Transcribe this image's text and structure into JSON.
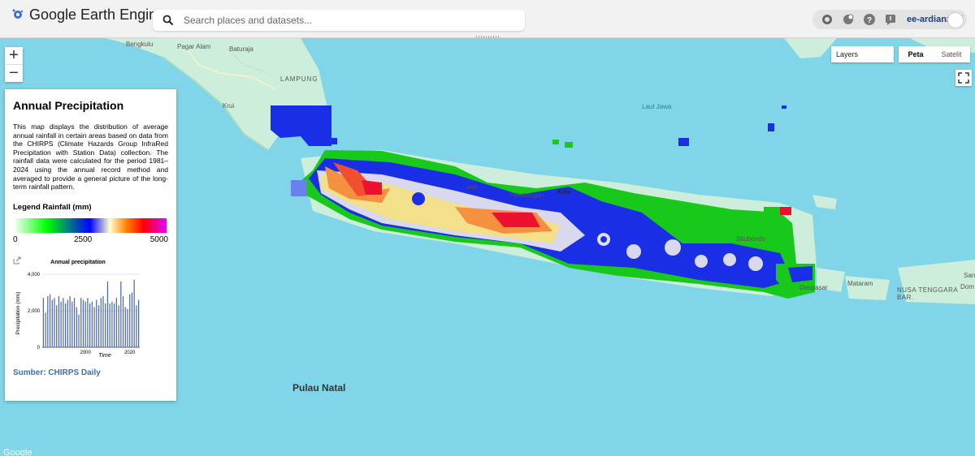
{
  "app": {
    "title": "Google Earth Engine"
  },
  "search": {
    "placeholder": "Search places and datasets..."
  },
  "header": {
    "user": "ee-ardianzaki"
  },
  "map_controls": {
    "zoom_in": "+",
    "zoom_out": "−",
    "layers": "Layers",
    "map_types": [
      "Peta",
      "Satelit"
    ],
    "selected_type": "Peta"
  },
  "panel": {
    "title": "Annual Precipitation",
    "description": "This map displays the distribution of average annual rainfall in certain areas based on data from the CHIRPS (Climate Hazards Group InfraRed Precipitation with Station Data) collection. The rainfall data were calculated for the period 1981–2024 using the annual record method and averaged to provide a general picture of the long-term rainfall pattern.",
    "legend_title": "Legend Rainfall (mm)",
    "legend_labels": [
      "0",
      "2500",
      "5000"
    ],
    "source": "Sumber: CHIRPS Daily"
  },
  "map_labels": {
    "bengkulu": "Bengkulu",
    "pagar_alam": "Pagar Alam",
    "baturaja": "Baturaja",
    "lampung": "LAMPUNG",
    "krui": "Krui",
    "laut_jawa": "Laut Jawa",
    "pulau_natal": "Pulau Natal",
    "mataram": "Mataram",
    "nusa_tenggara": "NUSA TENGGARA BAR.",
    "situbondo": "Situbondo",
    "denpasar": "Denpasar",
    "san": "San",
    "dom": "Dom",
    "pekalongan": "Pekalongan",
    "kota": "Kota",
    "bon": "bon",
    "google": "Google"
  },
  "colors": {
    "sea": "#80d6e8",
    "land": "#cfeedd",
    "rain_low": "#00cc00",
    "rain_mid": "#0000ee",
    "rain_high": "#ff0000",
    "bar": "#4a68b0"
  },
  "chart_data": {
    "type": "bar",
    "title": "Annual precipitation",
    "xlabel": "Time",
    "ylabel": "Precipitation (mm)",
    "y_ticks": [
      "0",
      "2,000",
      "4,000"
    ],
    "x_ticks": [
      "2000",
      "2020"
    ],
    "ylim": [
      0,
      4000
    ],
    "x": [
      1981,
      1982,
      1983,
      1984,
      1985,
      1986,
      1987,
      1988,
      1989,
      1990,
      1991,
      1992,
      1993,
      1994,
      1995,
      1996,
      1997,
      1998,
      1999,
      2000,
      2001,
      2002,
      2003,
      2004,
      2005,
      2006,
      2007,
      2008,
      2009,
      2010,
      2011,
      2012,
      2013,
      2014,
      2015,
      2016,
      2017,
      2018,
      2019,
      2020,
      2021,
      2022,
      2023,
      2024
    ],
    "values": [
      2700,
      1900,
      2800,
      2900,
      2600,
      2700,
      2300,
      2800,
      2500,
      2700,
      2400,
      2600,
      2800,
      2500,
      2700,
      2200,
      1800,
      2700,
      2600,
      2500,
      2700,
      2400,
      2500,
      2200,
      2600,
      2300,
      2700,
      2800,
      2400,
      3600,
      2400,
      2500,
      2400,
      2700,
      2300,
      3600,
      2800,
      2200,
      2100,
      2900,
      3000,
      3700,
      2300,
      2600
    ]
  }
}
